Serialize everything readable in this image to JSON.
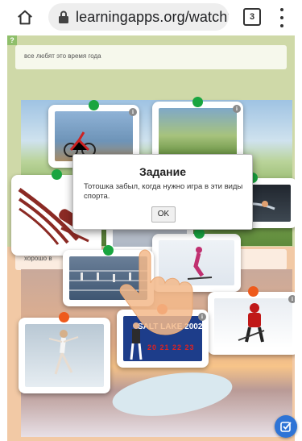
{
  "browser": {
    "url": "learningapps.org/watch?",
    "tab_count": "3"
  },
  "app": {
    "corner_icon": "?",
    "category_top": "все любят это время года",
    "category_bottom": "хорошо в"
  },
  "dialog": {
    "title": "Задание",
    "text": "Тотошка забыл, когда нужно игра в эти виды спорта.",
    "ok_label": "OK"
  },
  "cards": {
    "biathlon_banner": "SALT LAKE 2002",
    "banner_numbers": "20 21 22 23"
  },
  "colors": {
    "marker_green": "#19a540",
    "marker_orange": "#ee5a1c",
    "check_button": "#2e74d6",
    "bobsleigh_logo": "#8b2a24"
  },
  "icons": [
    "home-icon",
    "lock-icon",
    "tabs-icon",
    "more-vert-icon",
    "info-icon",
    "hand-pointer-icon",
    "check-icon"
  ]
}
